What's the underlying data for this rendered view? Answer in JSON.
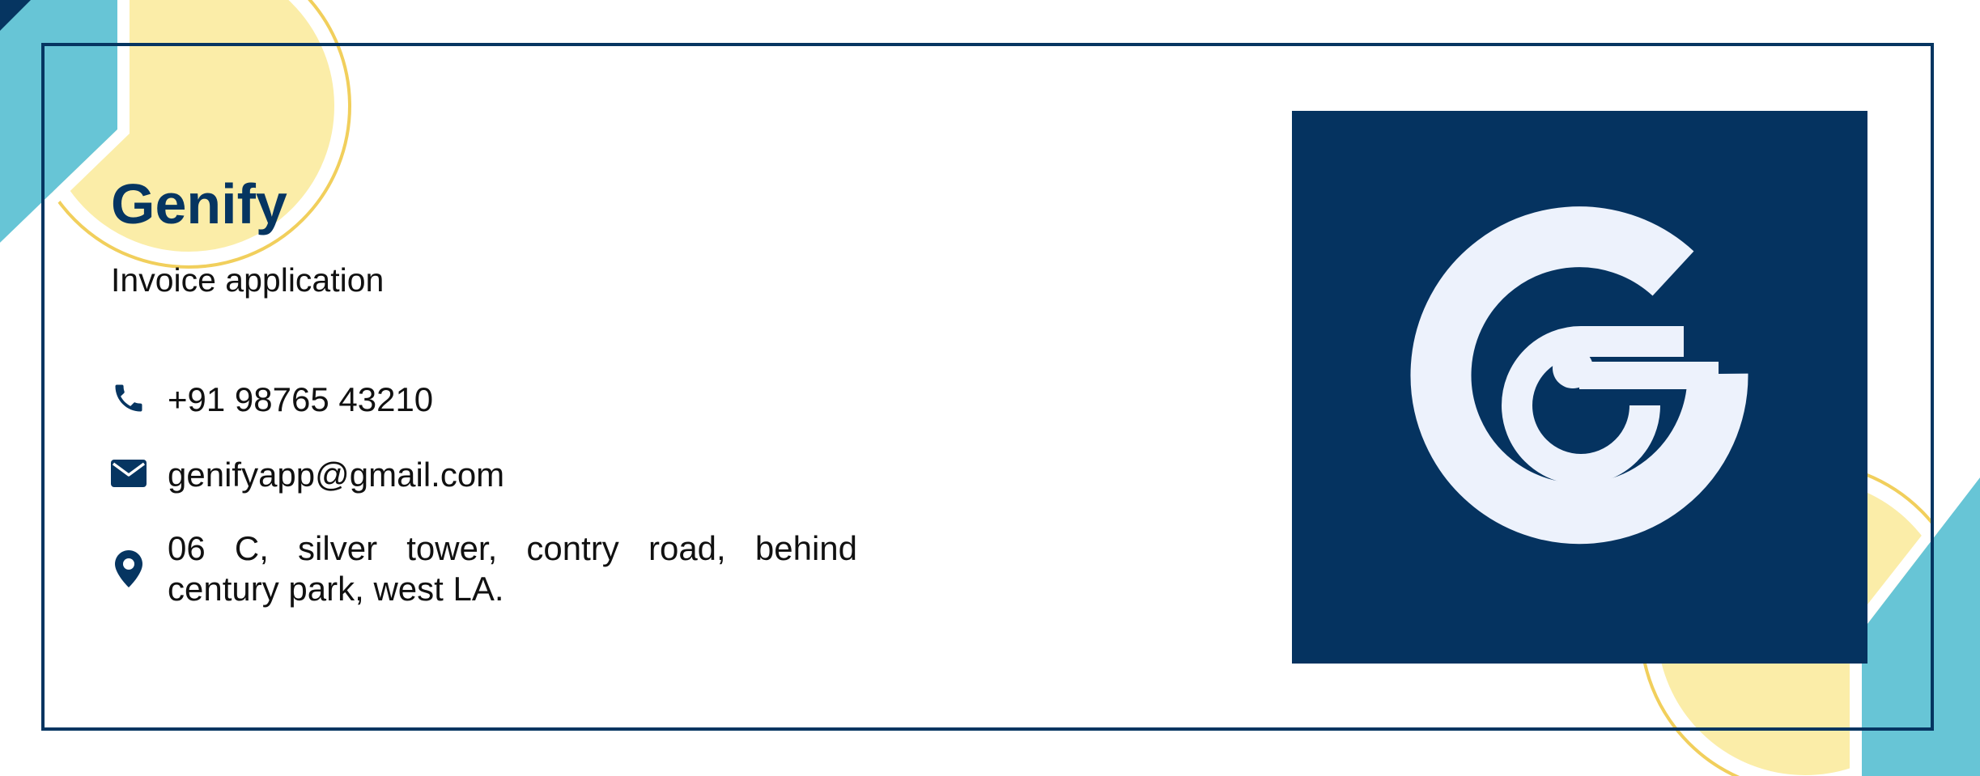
{
  "brand": {
    "name": "Genify",
    "tagline": "Invoice application",
    "logo_icon": "genify-g-logo-icon"
  },
  "contact": {
    "phone": "+91 98765 43210",
    "email": "genifyapp@gmail.com",
    "address": "06 C, silver tower, contry road, behind century park, west LA."
  },
  "icons": {
    "phone": "phone-icon",
    "email": "envelope-icon",
    "address": "map-pin-icon"
  },
  "colors": {
    "navy": "#063561",
    "yellow": "#FBEDA8",
    "yellow_outline": "#F1CF5C",
    "teal": "#67C5D6",
    "logo_glyph": "#EDF2FC"
  }
}
